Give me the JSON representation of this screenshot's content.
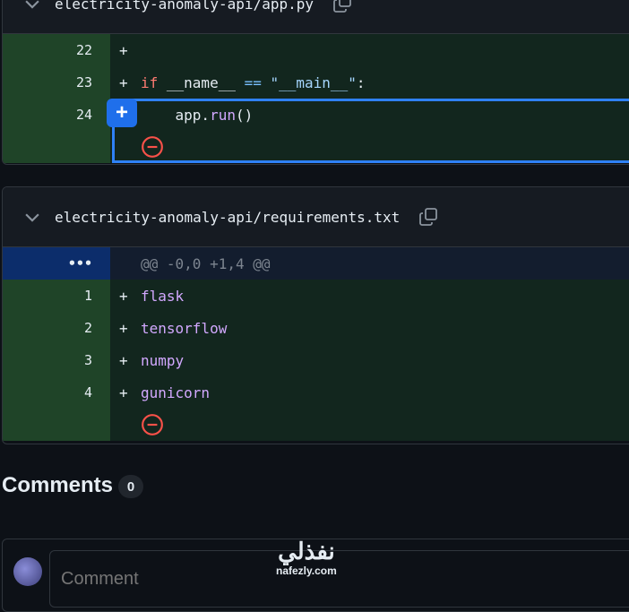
{
  "file1": {
    "name": "electricity-anomaly-api/app.py",
    "lines": [
      {
        "num": "22",
        "sign": "+",
        "content": ""
      },
      {
        "num": "23",
        "sign": "+",
        "content": "if __name__ == \"__main__\":"
      },
      {
        "num": "24",
        "sign": "",
        "content": "    app.run()"
      }
    ]
  },
  "file2": {
    "name": "electricity-anomaly-api/requirements.txt",
    "hunk": {
      "gutter": "•••",
      "header": "@@ -0,0 +1,4 @@"
    },
    "lines": [
      {
        "num": "1",
        "sign": "+",
        "content": "flask"
      },
      {
        "num": "2",
        "sign": "+",
        "content": "tensorflow"
      },
      {
        "num": "3",
        "sign": "+",
        "content": "numpy"
      },
      {
        "num": "4",
        "sign": "+",
        "content": "gunicorn"
      }
    ]
  },
  "comments": {
    "title": "Comments",
    "count": "0",
    "placeholder": "Comment"
  },
  "watermark": {
    "logo": "نفذلي",
    "url": "nafezly.com"
  },
  "icons": {
    "add": "plus-icon",
    "remove": "minus-circle-icon",
    "collapse": "chevron-down-icon",
    "copy": "copy-icon"
  }
}
